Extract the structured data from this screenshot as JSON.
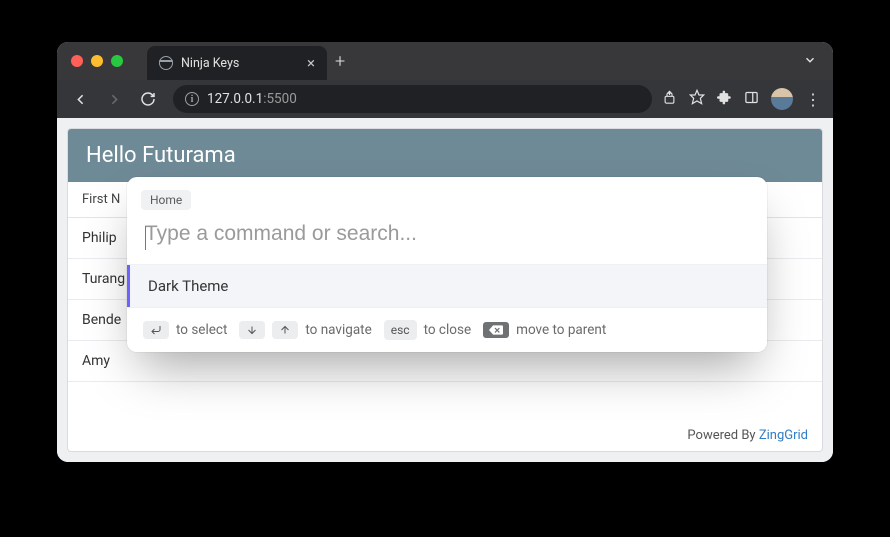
{
  "browser": {
    "tab_title": "Ninja Keys",
    "url_host": "127.0.0.1",
    "url_port": ":5500"
  },
  "page": {
    "title": "Hello Futurama",
    "column_header": "First N",
    "rows": [
      "Philip",
      "Turang",
      "Bende",
      "Amy"
    ],
    "footer_prefix": "Powered By ",
    "footer_brand": "ZingGrid"
  },
  "palette": {
    "breadcrumb": "Home",
    "placeholder": "Type a command or search...",
    "results": [
      "Dark Theme"
    ],
    "hints": {
      "select": "to select",
      "navigate": "to navigate",
      "esc_key": "esc",
      "close": "to close",
      "parent": "move to parent"
    }
  }
}
